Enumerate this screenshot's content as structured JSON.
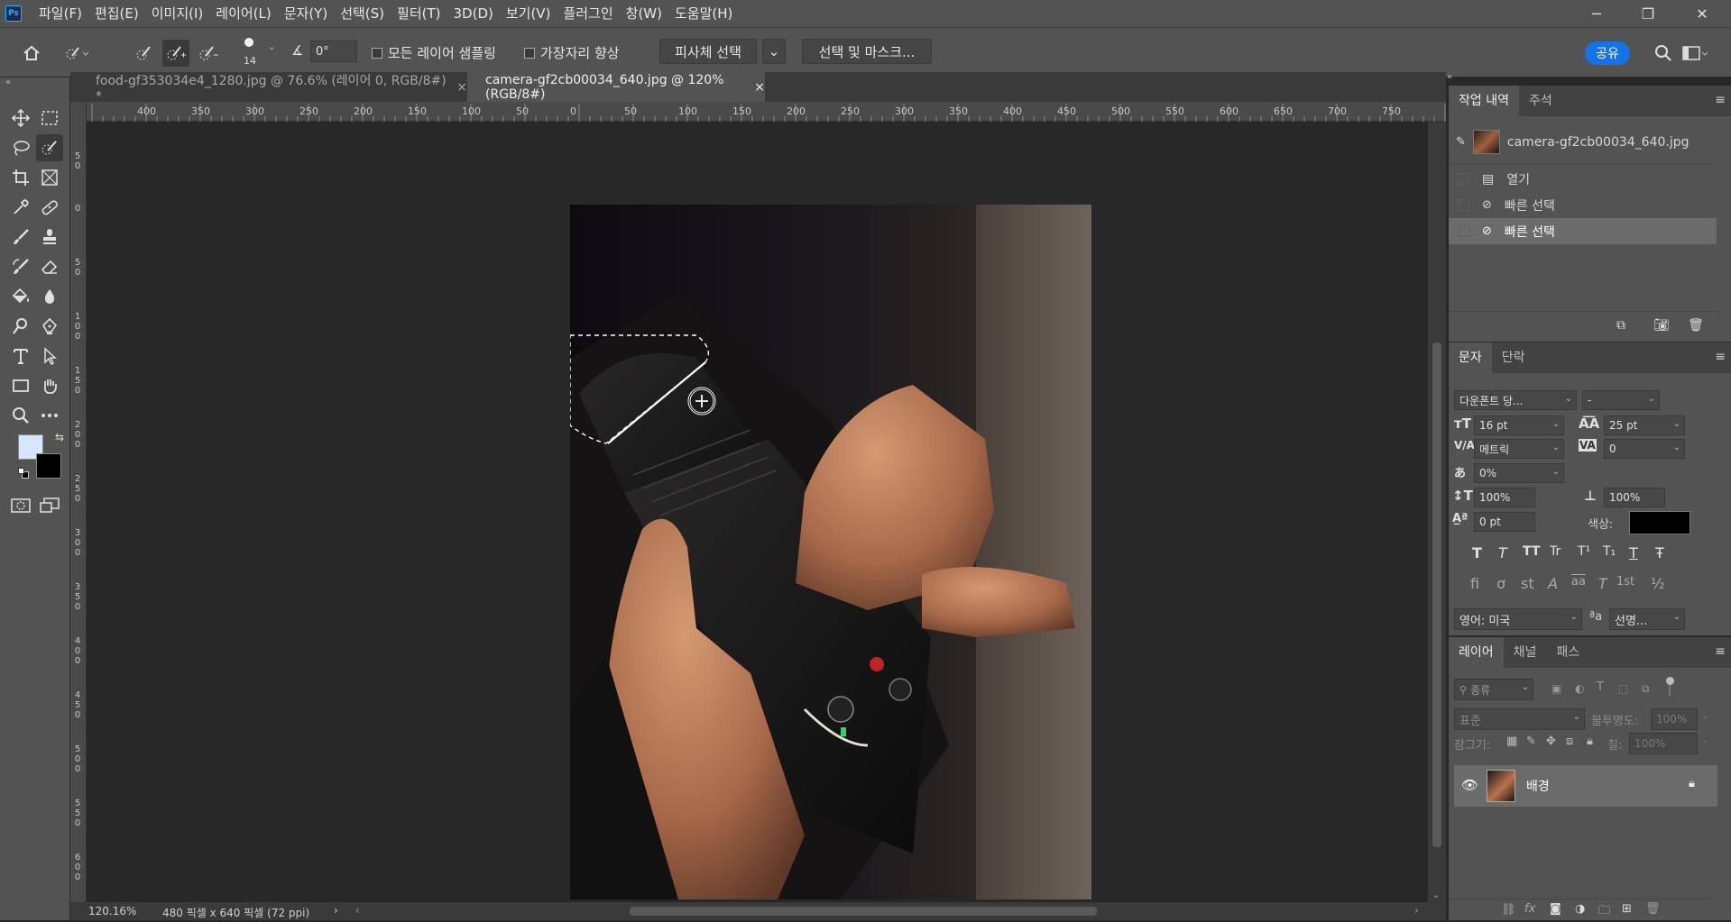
{
  "app": {
    "logo": "Ps"
  },
  "menu": [
    "파일(F)",
    "편집(E)",
    "이미지(I)",
    "레이어(L)",
    "문자(Y)",
    "선택(S)",
    "필터(T)",
    "3D(D)",
    "보기(V)",
    "플러그인",
    "창(W)",
    "도움말(H)"
  ],
  "window": {
    "minimize": "─",
    "restore": "❐",
    "close": "✕"
  },
  "options": {
    "brush_size": "14",
    "angle": "0°",
    "sample_all_layers": "모든 레이어 샘플링",
    "enhance_edge": "가장자리 향상",
    "select_subject": "피사체 선택",
    "select_and_mask": "선택 및 마스크...",
    "share": "공유"
  },
  "tabs": [
    {
      "label": "food-gf353034e4_1280.jpg @ 76.6% (레이어 0, RGB/8#) *",
      "close": "×"
    },
    {
      "label": "camera-gf2cb00034_640.jpg @ 120% (RGB/8#)",
      "close": "×"
    }
  ],
  "ruler_top": [
    "400",
    "350",
    "300",
    "250",
    "200",
    "150",
    "100",
    "50",
    "0",
    "50",
    "100",
    "150",
    "200",
    "250",
    "300",
    "350",
    "400",
    "450",
    "500",
    "550",
    "600",
    "650",
    "700",
    "750"
  ],
  "ruler_left": [
    "5\n0",
    "0",
    "5\n0",
    "1\n0\n0",
    "1\n5\n0",
    "2\n0\n0",
    "2\n5\n0",
    "3\n0\n0",
    "3\n5\n0",
    "4\n0\n0",
    "4\n5\n0",
    "5\n0\n0",
    "5\n5\n0",
    "6\n0\n0"
  ],
  "status": {
    "zoom": "120.16%",
    "info": "480 픽셀 x 640 픽셀 (72 ppi)"
  },
  "history": {
    "tabs": [
      "작업 내역",
      "주석"
    ],
    "snapshot": "camera-gf2cb00034_640.jpg",
    "items": [
      "열기",
      "빠른 선택",
      "빠른 선택"
    ]
  },
  "character": {
    "tabs": [
      "문자",
      "단락"
    ],
    "font": "다운폰트 당...",
    "style": "-",
    "size": "16 pt",
    "leading": "25 pt",
    "kerning": "메트릭",
    "tracking": "0",
    "tsume": "0%",
    "vscale": "100%",
    "hscale": "100%",
    "baseline": "0 pt",
    "color_label": "색상:",
    "color": "#000000",
    "style_buttons": [
      "T",
      "T",
      "TT",
      "Tr",
      "T¹",
      "T₁",
      "T",
      "Ŧ"
    ],
    "ot_buttons": [
      "fi",
      "ơ",
      "st",
      "A",
      "aa",
      "T",
      "1st",
      "½"
    ],
    "language": "영어: 미국",
    "aa_icon": "ªa",
    "antialias": "선명..."
  },
  "layers": {
    "tabs": [
      "레이어",
      "채널",
      "패스"
    ],
    "filter": "종류",
    "blend": "표준",
    "opacity_label": "불투명도:",
    "opacity": "100%",
    "lock_label": "잠그기:",
    "fill_label": "칠:",
    "fill": "100%",
    "items": [
      {
        "name": "배경",
        "visible": true,
        "locked": true
      }
    ]
  },
  "colors": {
    "foreground": "#d6e6ff",
    "background": "#000000",
    "accent": "#1473e6"
  }
}
